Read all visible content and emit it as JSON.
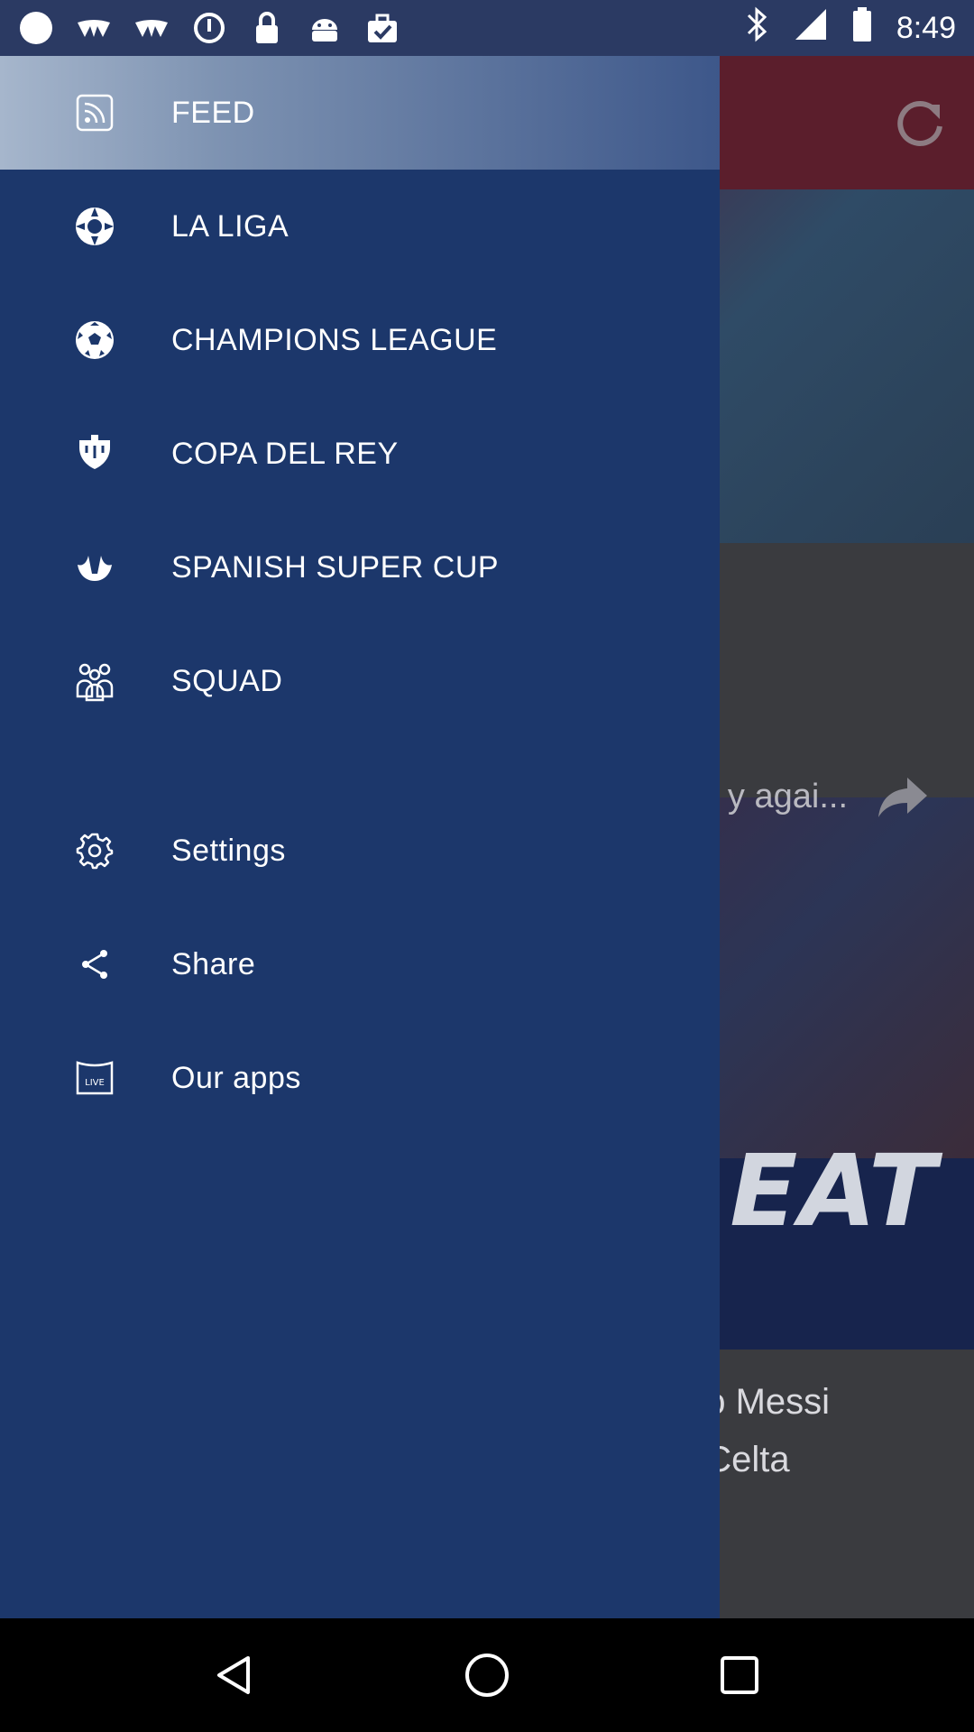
{
  "status_bar": {
    "time": "8:49",
    "icons": [
      "circle-notification-icon",
      "wings-icon",
      "wings-icon",
      "timer-icon",
      "lock-icon",
      "android-icon",
      "briefcase-check-icon",
      "bluetooth-icon",
      "signal-icon",
      "battery-icon"
    ]
  },
  "drawer": {
    "items": [
      {
        "label": "FEED",
        "icon": "rss-feed-icon",
        "active": true
      },
      {
        "label": "LA LIGA",
        "icon": "laliga-logo-icon"
      },
      {
        "label": "CHAMPIONS LEAGUE",
        "icon": "soccer-ball-icon"
      },
      {
        "label": "COPA DEL REY",
        "icon": "trophy-icon"
      },
      {
        "label": "SPANISH SUPER CUP",
        "icon": "super-cup-icon"
      },
      {
        "label": "SQUAD",
        "icon": "squad-icon"
      },
      {
        "label": "Settings",
        "icon": "gear-icon"
      },
      {
        "label": "Share",
        "icon": "share-icon"
      },
      {
        "label": "Our apps",
        "icon": "live-app-icon"
      }
    ]
  },
  "background": {
    "video_title_fragment": "y agai...",
    "banner_fragment": "REAT",
    "article_line1": "eo Messi",
    "article_line2": "t Celta"
  },
  "colors": {
    "drawer": "#1c376b",
    "status_bar": "#2b3a63",
    "app_bar": "#5b1e2c"
  }
}
